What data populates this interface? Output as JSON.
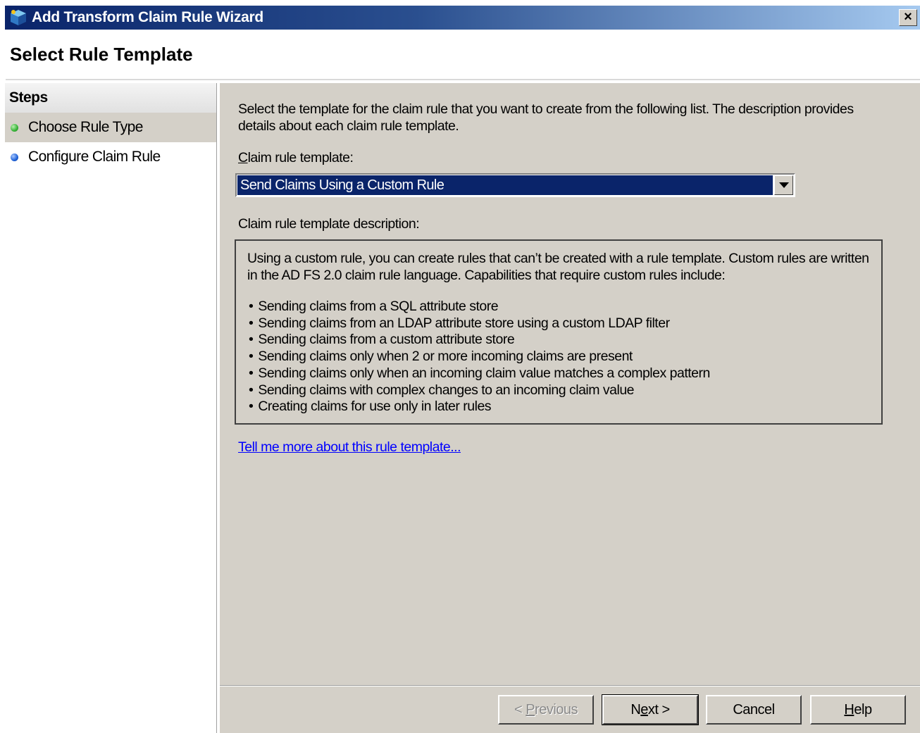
{
  "window": {
    "title": "Add Transform Claim Rule Wizard",
    "close_glyph": "×",
    "icon": "wizard-cube-icon"
  },
  "header": {
    "title": "Select Rule Template"
  },
  "steps": {
    "heading": "Steps",
    "items": [
      {
        "label": "Choose Rule Type",
        "state": "current",
        "color": "#36b336"
      },
      {
        "label": "Configure Claim Rule",
        "state": "pending",
        "color": "#1f62d8"
      }
    ]
  },
  "content": {
    "intro": "Select the template for the claim rule that you want to create from the following list. The description provides details about each claim rule template.",
    "template_label_hotkey": "C",
    "template_label_rest": "laim rule template:",
    "template_selected": "Send Claims Using a Custom Rule",
    "description_label": "Claim rule template description:",
    "description_text": "Using a custom rule, you can create rules that can’t be created with a rule template.  Custom rules are written in the AD FS 2.0 claim rule language.  Capabilities that require custom rules include:",
    "capabilities": [
      "Sending claims from a SQL attribute store",
      "Sending claims from an LDAP attribute store using a custom LDAP filter",
      "Sending claims from a custom attribute store",
      "Sending claims only when 2 or more incoming claims are present",
      "Sending claims only when an incoming claim value matches a complex pattern",
      "Sending claims with complex changes to an incoming claim value",
      "Creating claims for use only in later rules"
    ],
    "help_link": "Tell me more about this rule template..."
  },
  "footer": {
    "previous_prefix": "< ",
    "previous_hotkey": "P",
    "previous_rest": "revious",
    "next_prefix": "N",
    "next_hotkey": "e",
    "next_rest": "xt >",
    "cancel": "Cancel",
    "help_hotkey": "H",
    "help_rest": "elp"
  }
}
